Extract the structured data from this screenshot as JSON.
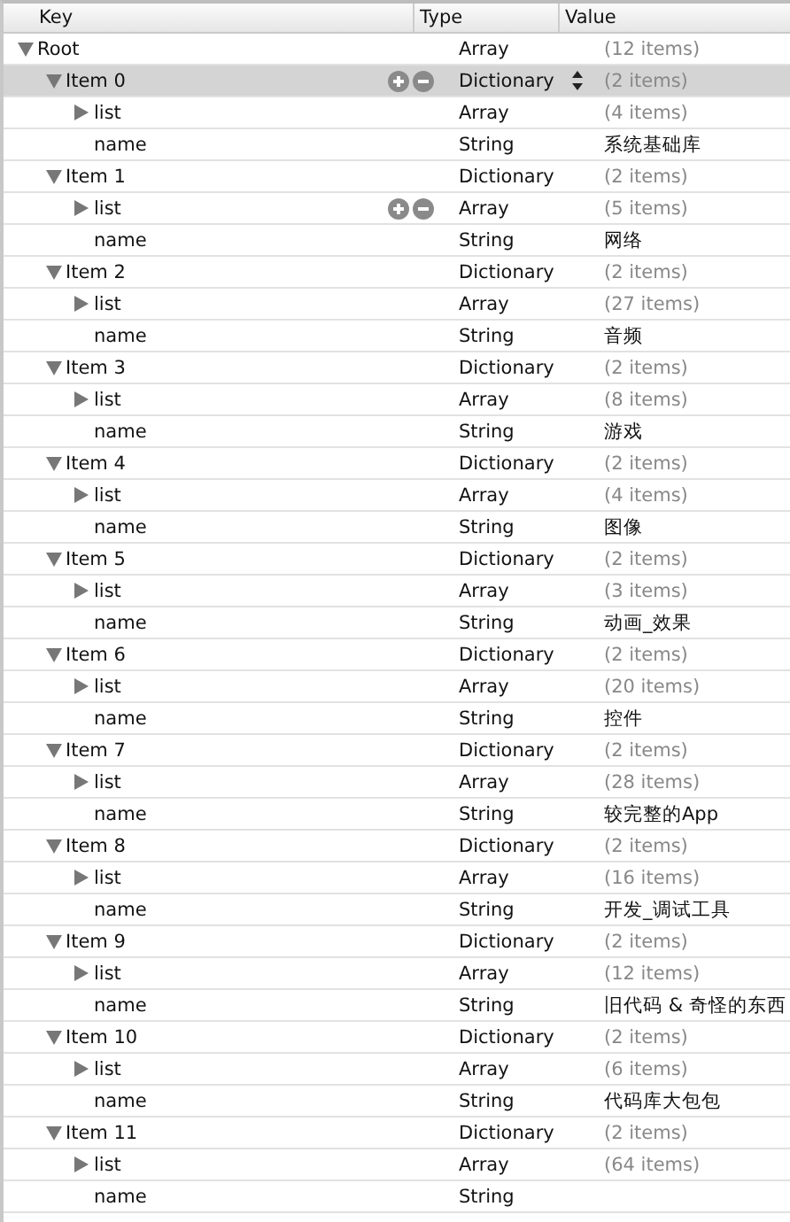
{
  "columns": [
    "Key",
    "Type",
    "Value"
  ],
  "root": {
    "key": "Root",
    "type": "Array",
    "value": "(12 items)",
    "expanded": true,
    "selected": false,
    "children": [
      {
        "key": "Item 0",
        "type": "Dictionary",
        "value": "(2 items)",
        "expanded": true,
        "selected": true,
        "show_controls": true,
        "children": [
          {
            "key": "list",
            "type": "Array",
            "value": "(4 items)",
            "expanded": false,
            "selected": false
          },
          {
            "key": "name",
            "type": "String",
            "value": "系统基础库",
            "selected": false
          }
        ]
      },
      {
        "key": "Item 1",
        "type": "Dictionary",
        "value": "(2 items)",
        "expanded": true,
        "selected": false,
        "children": [
          {
            "key": "list",
            "type": "Array",
            "value": "(5 items)",
            "expanded": false,
            "selected": false,
            "show_controls": true
          },
          {
            "key": "name",
            "type": "String",
            "value": "网络",
            "selected": false
          }
        ]
      },
      {
        "key": "Item 2",
        "type": "Dictionary",
        "value": "(2 items)",
        "expanded": true,
        "selected": false,
        "children": [
          {
            "key": "list",
            "type": "Array",
            "value": "(27 items)",
            "expanded": false,
            "selected": false
          },
          {
            "key": "name",
            "type": "String",
            "value": "音频",
            "selected": false
          }
        ]
      },
      {
        "key": "Item 3",
        "type": "Dictionary",
        "value": "(2 items)",
        "expanded": true,
        "selected": false,
        "children": [
          {
            "key": "list",
            "type": "Array",
            "value": "(8 items)",
            "expanded": false,
            "selected": false
          },
          {
            "key": "name",
            "type": "String",
            "value": "游戏",
            "selected": false
          }
        ]
      },
      {
        "key": "Item 4",
        "type": "Dictionary",
        "value": "(2 items)",
        "expanded": true,
        "selected": false,
        "children": [
          {
            "key": "list",
            "type": "Array",
            "value": "(4 items)",
            "expanded": false,
            "selected": false
          },
          {
            "key": "name",
            "type": "String",
            "value": "图像",
            "selected": false
          }
        ]
      },
      {
        "key": "Item 5",
        "type": "Dictionary",
        "value": "(2 items)",
        "expanded": true,
        "selected": false,
        "children": [
          {
            "key": "list",
            "type": "Array",
            "value": "(3 items)",
            "expanded": false,
            "selected": false
          },
          {
            "key": "name",
            "type": "String",
            "value": "动画_效果",
            "selected": false
          }
        ]
      },
      {
        "key": "Item 6",
        "type": "Dictionary",
        "value": "(2 items)",
        "expanded": true,
        "selected": false,
        "children": [
          {
            "key": "list",
            "type": "Array",
            "value": "(20 items)",
            "expanded": false,
            "selected": false
          },
          {
            "key": "name",
            "type": "String",
            "value": "控件",
            "selected": false
          }
        ]
      },
      {
        "key": "Item 7",
        "type": "Dictionary",
        "value": "(2 items)",
        "expanded": true,
        "selected": false,
        "children": [
          {
            "key": "list",
            "type": "Array",
            "value": "(28 items)",
            "expanded": false,
            "selected": false
          },
          {
            "key": "name",
            "type": "String",
            "value": "较完整的App",
            "selected": false
          }
        ]
      },
      {
        "key": "Item 8",
        "type": "Dictionary",
        "value": "(2 items)",
        "expanded": true,
        "selected": false,
        "children": [
          {
            "key": "list",
            "type": "Array",
            "value": "(16 items)",
            "expanded": false,
            "selected": false
          },
          {
            "key": "name",
            "type": "String",
            "value": "开发_调试工具",
            "selected": false
          }
        ]
      },
      {
        "key": "Item 9",
        "type": "Dictionary",
        "value": "(2 items)",
        "expanded": true,
        "selected": false,
        "children": [
          {
            "key": "list",
            "type": "Array",
            "value": "(12 items)",
            "expanded": false,
            "selected": false
          },
          {
            "key": "name",
            "type": "String",
            "value": "旧代码 & 奇怪的东西",
            "selected": false
          }
        ]
      },
      {
        "key": "Item 10",
        "type": "Dictionary",
        "value": "(2 items)",
        "expanded": true,
        "selected": false,
        "children": [
          {
            "key": "list",
            "type": "Array",
            "value": "(6 items)",
            "expanded": false,
            "selected": false
          },
          {
            "key": "name",
            "type": "String",
            "value": "代码库大包包",
            "selected": false
          }
        ]
      },
      {
        "key": "Item 11",
        "type": "Dictionary",
        "value": "(2 items)",
        "expanded": true,
        "selected": false,
        "children": [
          {
            "key": "list",
            "type": "Array",
            "value": "(64 items)",
            "expanded": false,
            "selected": false
          },
          {
            "key": "name",
            "type": "String",
            "selected": false
          }
        ]
      }
    ]
  }
}
